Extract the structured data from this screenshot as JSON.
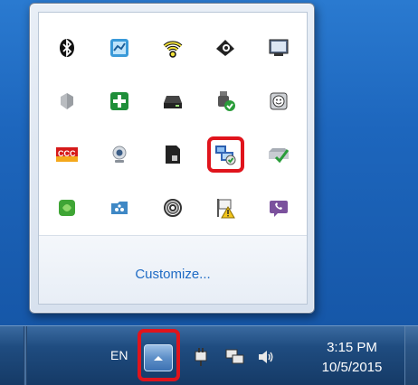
{
  "popup": {
    "customize_label": "Customize...",
    "icons": [
      [
        "bluetooth-icon",
        "network-monitor-icon",
        "wifi-icon",
        "headset-icon",
        "display-icon"
      ],
      [
        "shield-gray-icon",
        "green-shield-icon",
        "drive-icon",
        "usb-safely-remove-icon",
        "smiley-drive-icon"
      ],
      [
        "ccc-icon",
        "webcam-icon",
        "sim-card-icon",
        "network-connection-icon",
        "printer-check-icon"
      ],
      [
        "green-app-icon",
        "network-share-icon",
        "spiral-icon",
        "action-center-flag-icon",
        "viber-icon"
      ]
    ]
  },
  "taskbar": {
    "language": "EN",
    "time": "3:15 PM",
    "date": "10/5/2015"
  }
}
